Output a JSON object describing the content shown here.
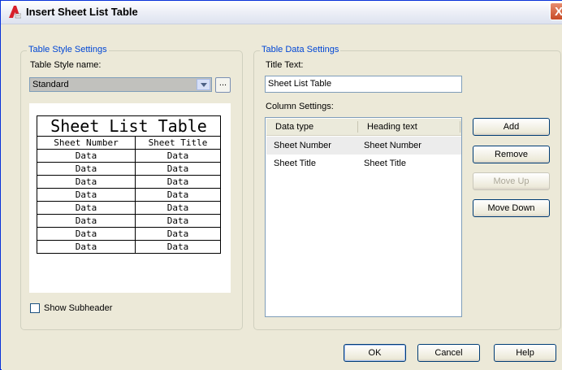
{
  "window": {
    "title": "Insert Sheet List Table",
    "close_glyph": "X"
  },
  "table_style": {
    "group_label": "Table Style Settings",
    "name_label": "Table Style name:",
    "selected_style": "Standard",
    "browse_label": "...",
    "preview": {
      "title": "Sheet List Table",
      "headers": [
        "Sheet Number",
        "Sheet Title"
      ],
      "rows": [
        [
          "Data",
          "Data"
        ],
        [
          "Data",
          "Data"
        ],
        [
          "Data",
          "Data"
        ],
        [
          "Data",
          "Data"
        ],
        [
          "Data",
          "Data"
        ],
        [
          "Data",
          "Data"
        ],
        [
          "Data",
          "Data"
        ],
        [
          "Data",
          "Data"
        ]
      ]
    },
    "show_subheader": {
      "label": "Show Subheader",
      "checked": false
    }
  },
  "table_data": {
    "group_label": "Table Data Settings",
    "title_label": "Title Text:",
    "title_value": "Sheet List Table",
    "column_label": "Column Settings:",
    "columns_header": [
      "Data type",
      "Heading text"
    ],
    "columns": [
      {
        "data_type": "Sheet Number",
        "heading": "Sheet Number",
        "selected": true
      },
      {
        "data_type": "Sheet Title",
        "heading": "Sheet Title",
        "selected": false
      }
    ],
    "buttons": {
      "add": "Add",
      "remove": "Remove",
      "move_up": "Move Up",
      "move_down": "Move Down"
    }
  },
  "footer": {
    "ok": "OK",
    "cancel": "Cancel",
    "help": "Help"
  },
  "colors": {
    "accent": "#0046d5",
    "dialog_bg": "#ece9d8",
    "close": "#c74a26"
  }
}
